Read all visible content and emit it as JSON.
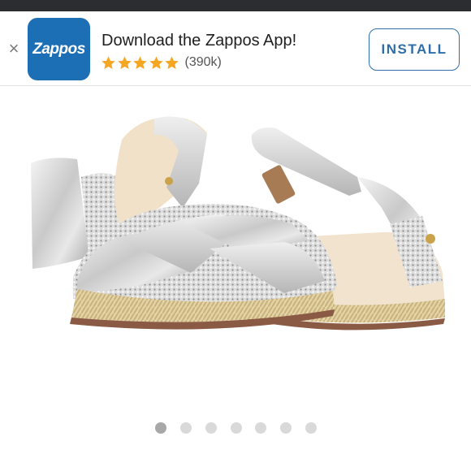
{
  "banner": {
    "close_glyph": "×",
    "app_icon_text": "Zappos",
    "title": "Download the Zappos App!",
    "rating_stars": 5,
    "rating_count": "(390k)",
    "install_label": "INSTALL",
    "colors": {
      "brand": "#1c6fb5",
      "star": "#f5a623",
      "install": "#2f6ea8"
    }
  },
  "product_image": {
    "icon": "silver-sandal-pair-image"
  },
  "carousel": {
    "total_dots": 7,
    "active_index": 0
  }
}
